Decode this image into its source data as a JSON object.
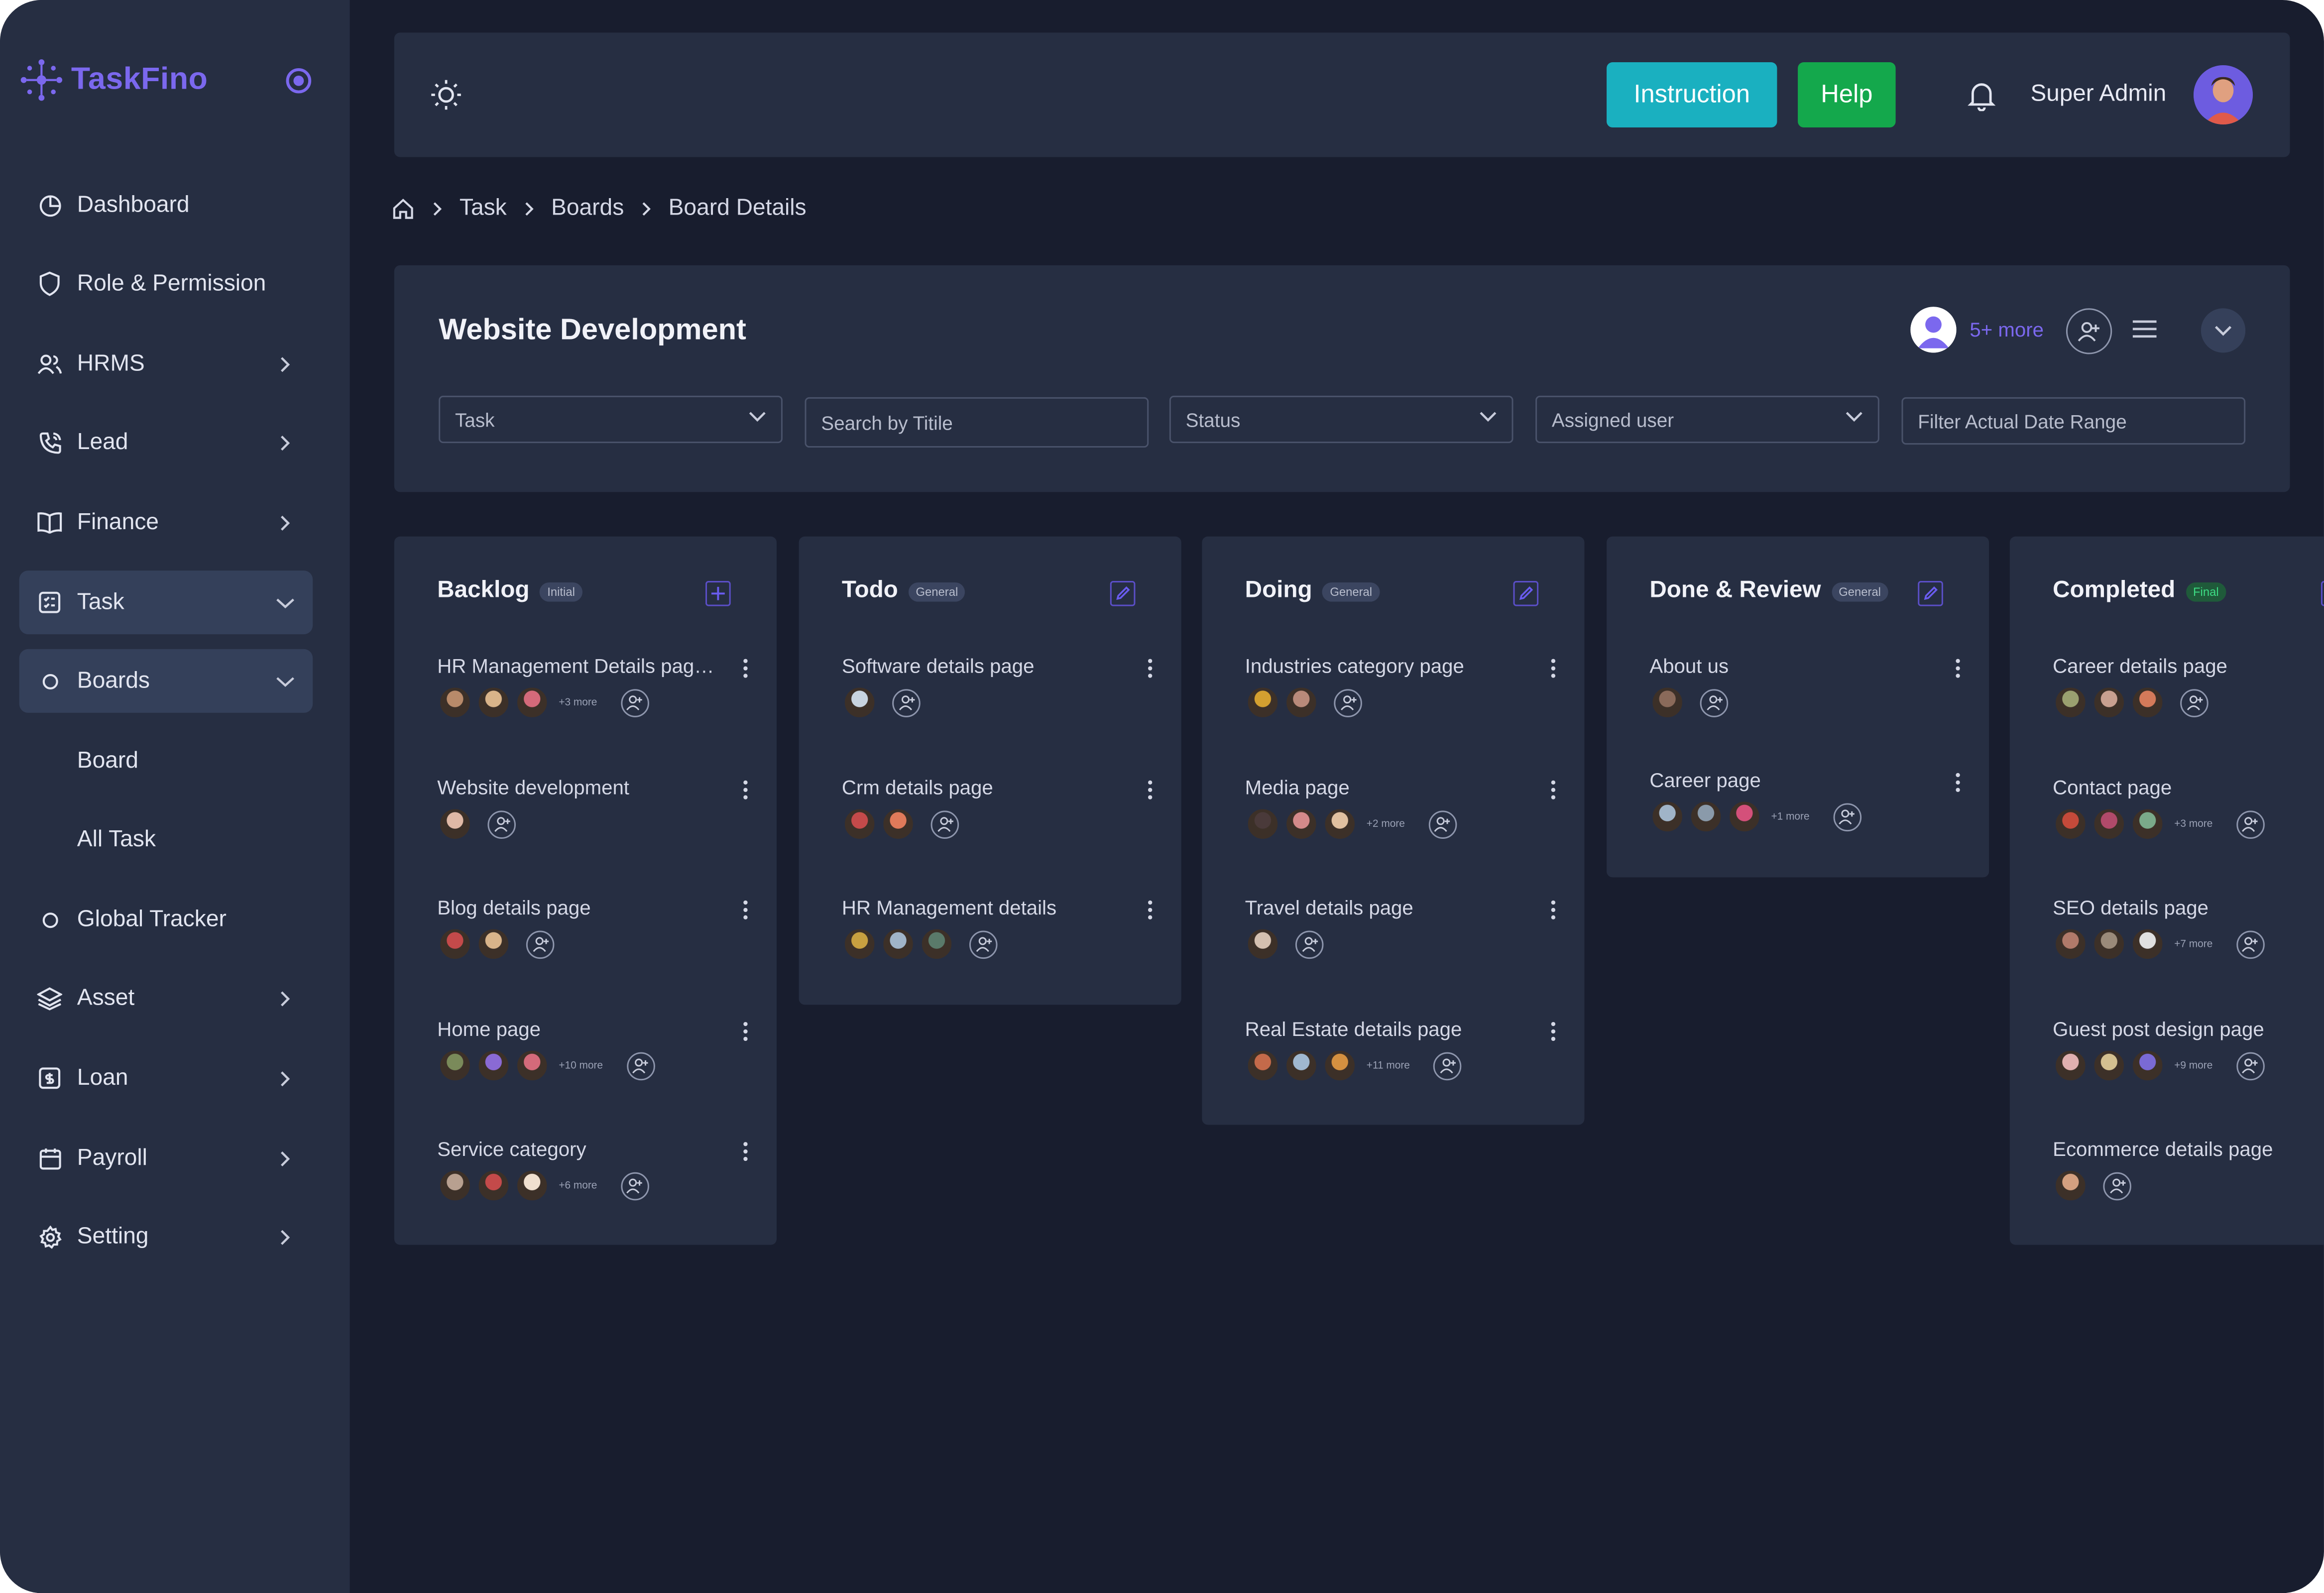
{
  "app": {
    "name": "TaskFino"
  },
  "sidebar": {
    "items": [
      {
        "label": "Dashboard",
        "icon": "pie-chart-icon",
        "chevron": "none"
      },
      {
        "label": "Role & Permission",
        "icon": "shield-icon",
        "chevron": "none"
      },
      {
        "label": "HRMS",
        "icon": "users-icon",
        "chevron": "right"
      },
      {
        "label": "Lead",
        "icon": "phone-icon",
        "chevron": "right"
      },
      {
        "label": "Finance",
        "icon": "book-icon",
        "chevron": "right"
      },
      {
        "label": "Task",
        "icon": "task-icon",
        "chevron": "down",
        "active": true
      },
      {
        "label": "Boards",
        "icon": "circle-icon",
        "chevron": "down",
        "active": true
      },
      {
        "label": "Board",
        "icon": "",
        "chevron": "none"
      },
      {
        "label": "All Task",
        "icon": "",
        "chevron": "none"
      },
      {
        "label": "Global Tracker",
        "icon": "circle-icon",
        "chevron": "none"
      },
      {
        "label": "Asset",
        "icon": "layers-icon",
        "chevron": "right"
      },
      {
        "label": "Loan",
        "icon": "loan-icon",
        "chevron": "right"
      },
      {
        "label": "Payroll",
        "icon": "calendar-icon",
        "chevron": "right"
      },
      {
        "label": "Setting",
        "icon": "gear-icon",
        "chevron": "right"
      }
    ]
  },
  "topbar": {
    "instruction_label": "Instruction",
    "help_label": "Help",
    "user_name": "Super Admin",
    "colors": {
      "instruction": "#1ab0c0",
      "help": "#14a84c",
      "accent": "#7b68ee"
    }
  },
  "breadcrumb": [
    "Task",
    "Boards",
    "Board Details"
  ],
  "board": {
    "title": "Website Development",
    "more_members": "5+ more",
    "filters": [
      {
        "label": "Task",
        "type": "select"
      },
      {
        "label": "Search by Titile",
        "type": "input"
      },
      {
        "label": "Status",
        "type": "select"
      },
      {
        "label": "Assigned user",
        "type": "select"
      },
      {
        "label": "Filter Actual Date Range",
        "type": "input"
      }
    ]
  },
  "columns": [
    {
      "title": "Backlog",
      "badge": "Initial",
      "action": "plus",
      "tasks": [
        {
          "title": "HR Management Details page...",
          "avatars": [
            "#b88a6a",
            "#d9b48a",
            "#d46a7a"
          ],
          "more": "+3 more"
        },
        {
          "title": "Website development",
          "avatars": [
            "#e0b9a6"
          ],
          "more": ""
        },
        {
          "title": "Blog details page",
          "avatars": [
            "#c44a4a",
            "#d9b48a"
          ],
          "more": ""
        },
        {
          "title": "Home page",
          "avatars": [
            "#7a8a5a",
            "#8a6ad4",
            "#d46a7a"
          ],
          "more": "+10 more"
        },
        {
          "title": "Service category",
          "avatars": [
            "#b8a090",
            "#c44a4a",
            "#f0e0d0"
          ],
          "more": "+6 more"
        }
      ]
    },
    {
      "title": "Todo",
      "badge": "General",
      "action": "edit",
      "tasks": [
        {
          "title": "Software details page",
          "avatars": [
            "#c8d4e0"
          ],
          "more": ""
        },
        {
          "title": "Crm details page",
          "avatars": [
            "#c44a4a",
            "#e07a5a"
          ],
          "more": ""
        },
        {
          "title": "HR Management details",
          "avatars": [
            "#c8a040",
            "#a0b4c8",
            "#5a7a6a"
          ],
          "more": ""
        }
      ]
    },
    {
      "title": "Doing",
      "badge": "General",
      "action": "edit",
      "tasks": [
        {
          "title": "Industries category page",
          "avatars": [
            "#d4a030",
            "#b88a7a"
          ],
          "more": ""
        },
        {
          "title": "Media page",
          "avatars": [
            "#4a3a3a",
            "#d48a8a",
            "#e0c0a0"
          ],
          "more": "+2 more"
        },
        {
          "title": "Travel details page",
          "avatars": [
            "#d4c0b0"
          ],
          "more": ""
        },
        {
          "title": "Real Estate details page",
          "avatars": [
            "#c46a4a",
            "#a0b8d0",
            "#d49040"
          ],
          "more": "+11 more"
        }
      ]
    },
    {
      "title": "Done & Review",
      "badge": "General",
      "action": "edit",
      "tasks": [
        {
          "title": "About us",
          "avatars": [
            "#8a6a5a"
          ],
          "more": ""
        },
        {
          "title": "Career page",
          "avatars": [
            "#a0b4c8",
            "#8a9aaa",
            "#d4507a"
          ],
          "more": "+1 more"
        }
      ]
    },
    {
      "title": "Completed",
      "badge": "Final",
      "action": "edit",
      "tasks": [
        {
          "title": "Career details page",
          "avatars": [
            "#9aa070",
            "#c8a090",
            "#d47a5a"
          ],
          "more": ""
        },
        {
          "title": "Contact page",
          "avatars": [
            "#c44a3a",
            "#b04a6a",
            "#7aaa8a"
          ],
          "more": "+3 more"
        },
        {
          "title": "SEO details page",
          "avatars": [
            "#b07a6a",
            "#9a8a7a",
            "#e0e0e0"
          ],
          "more": "+7 more"
        },
        {
          "title": "Guest post design page",
          "avatars": [
            "#e0b0b0",
            "#d4c090",
            "#7a6ad4"
          ],
          "more": "+9 more"
        },
        {
          "title": "Ecommerce details page",
          "avatars": [
            "#d4a080"
          ],
          "more": ""
        }
      ]
    }
  ]
}
